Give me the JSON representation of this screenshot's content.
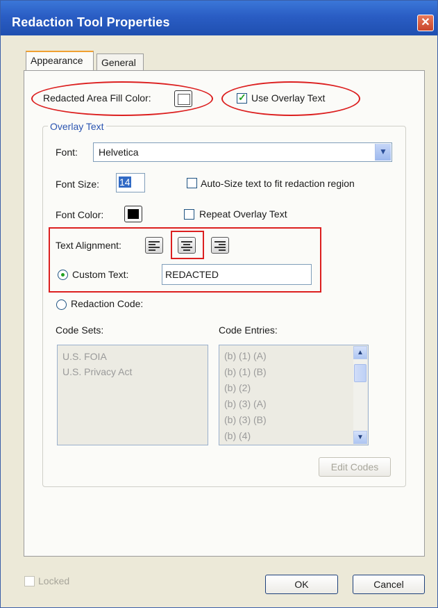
{
  "window": {
    "title": "Redaction Tool Properties",
    "close": "✕"
  },
  "tabs": [
    {
      "label": "Appearance",
      "active": true
    },
    {
      "label": "General",
      "active": false
    }
  ],
  "appearance": {
    "fill_color_label": "Redacted Area Fill Color:",
    "fill_color": "#ffffff",
    "use_overlay_label": "Use Overlay Text",
    "use_overlay_checked": true
  },
  "overlay": {
    "group_label": "Overlay Text",
    "font_label": "Font:",
    "font_value": "Helvetica",
    "font_size_label": "Font Size:",
    "font_size_value": "14",
    "auto_size_label": "Auto-Size text to fit redaction region",
    "auto_size_checked": false,
    "font_color_label": "Font Color:",
    "font_color": "#000000",
    "repeat_label": "Repeat Overlay Text",
    "repeat_checked": false,
    "alignment_label": "Text Alignment:",
    "alignment_selected": "center",
    "custom_text_label": "Custom Text:",
    "custom_text_value": "REDACTED",
    "custom_text_selected": true,
    "redaction_code_label": "Redaction Code:",
    "code_sets_label": "Code Sets:",
    "code_sets": [
      "U.S. FOIA",
      "U.S. Privacy Act"
    ],
    "code_entries_label": "Code Entries:",
    "code_entries": [
      "(b) (1) (A)",
      "(b) (1) (B)",
      "(b) (2)",
      "(b) (3) (A)",
      "(b) (3) (B)",
      "(b) (4)"
    ],
    "edit_codes_label": "Edit Codes"
  },
  "footer": {
    "locked_label": "Locked",
    "locked_checked": false,
    "ok_label": "OK",
    "cancel_label": "Cancel"
  },
  "colors": {
    "highlight": "#dc1f1f",
    "titlebar": "#2a5dc4",
    "check": "#21a121"
  }
}
